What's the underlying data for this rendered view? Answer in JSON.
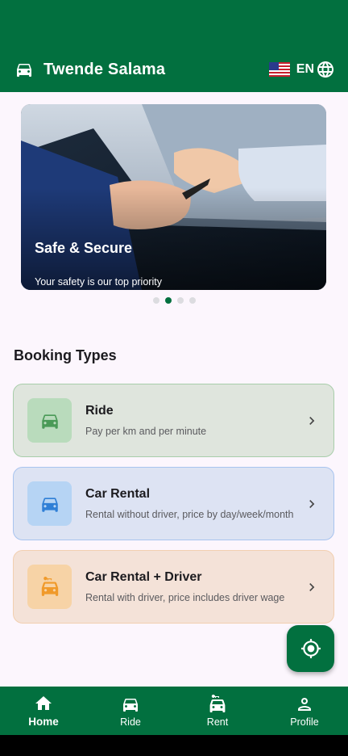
{
  "appbar": {
    "title": "Twende Salama",
    "language": "EN",
    "icons": {
      "logo": "car-icon",
      "flag": "us-flag-icon",
      "language": "globe-icon"
    }
  },
  "banner": {
    "title": "Safe & Secure",
    "subtitle": "Your safety is our top priority",
    "slide_count": 4,
    "active_slide": 2
  },
  "section": {
    "title": "Booking Types"
  },
  "booking_types": [
    {
      "title": "Ride",
      "subtitle": "Pay per km and per minute",
      "icon": "car-icon",
      "icon_color": "#4a9a57"
    },
    {
      "title": "Car Rental",
      "subtitle": "Rental without driver, price by day/week/month",
      "icon": "car-icon",
      "icon_color": "#2f7fd6"
    },
    {
      "title": "Car Rental + Driver",
      "subtitle": "Rental with driver, price includes driver wage",
      "icon": "car-rental-icon",
      "icon_color": "#f09a2a"
    }
  ],
  "fab": {
    "icon": "my-location-icon"
  },
  "bottom_nav": {
    "items": [
      {
        "label": "Home",
        "icon": "home-icon",
        "active": true
      },
      {
        "label": "Ride",
        "icon": "car-icon",
        "active": false
      },
      {
        "label": "Rent",
        "icon": "car-rental-icon",
        "active": false
      },
      {
        "label": "Profile",
        "icon": "person-icon",
        "active": false
      }
    ]
  },
  "colors": {
    "primary": "#02703f",
    "background": "#fcf6fd",
    "dot_inactive": "#dcdce0"
  }
}
